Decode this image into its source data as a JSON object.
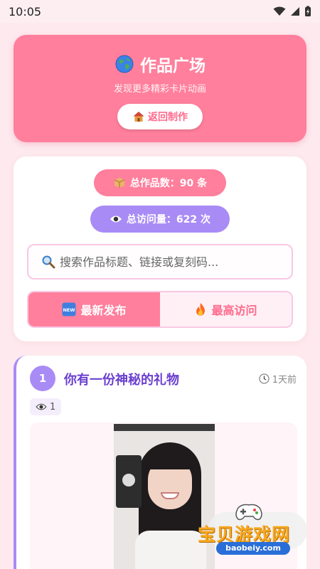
{
  "status_bar": {
    "time": "10:05"
  },
  "hero": {
    "title": "作品广场",
    "subtitle": "发现更多精彩卡片动画",
    "back_button": "返回制作",
    "title_icon": "globe-icon",
    "back_icon": "house-icon"
  },
  "stats": {
    "total_label": "总作品数：90 条",
    "visits_label": "总访问量：622 次"
  },
  "search": {
    "placeholder": "搜索作品标题、链接或复刻码..."
  },
  "tabs": [
    {
      "label": "最新发布",
      "icon": "new-badge-icon",
      "active": true
    },
    {
      "label": "最高访问",
      "icon": "fire-icon",
      "active": false
    }
  ],
  "works": [
    {
      "rank": "1",
      "title": "你有一份神秘的礼物",
      "time": "1天前",
      "views": "1"
    }
  ],
  "watermark": {
    "text": "宝贝游戏网",
    "url": "baobeiy.com"
  },
  "colors": {
    "background": "#fde9ee",
    "primary_pink": "#ff7f9c",
    "purple": "#a98bf6",
    "title_purple": "#6b3fd0",
    "search_border": "#f8c8e4"
  }
}
